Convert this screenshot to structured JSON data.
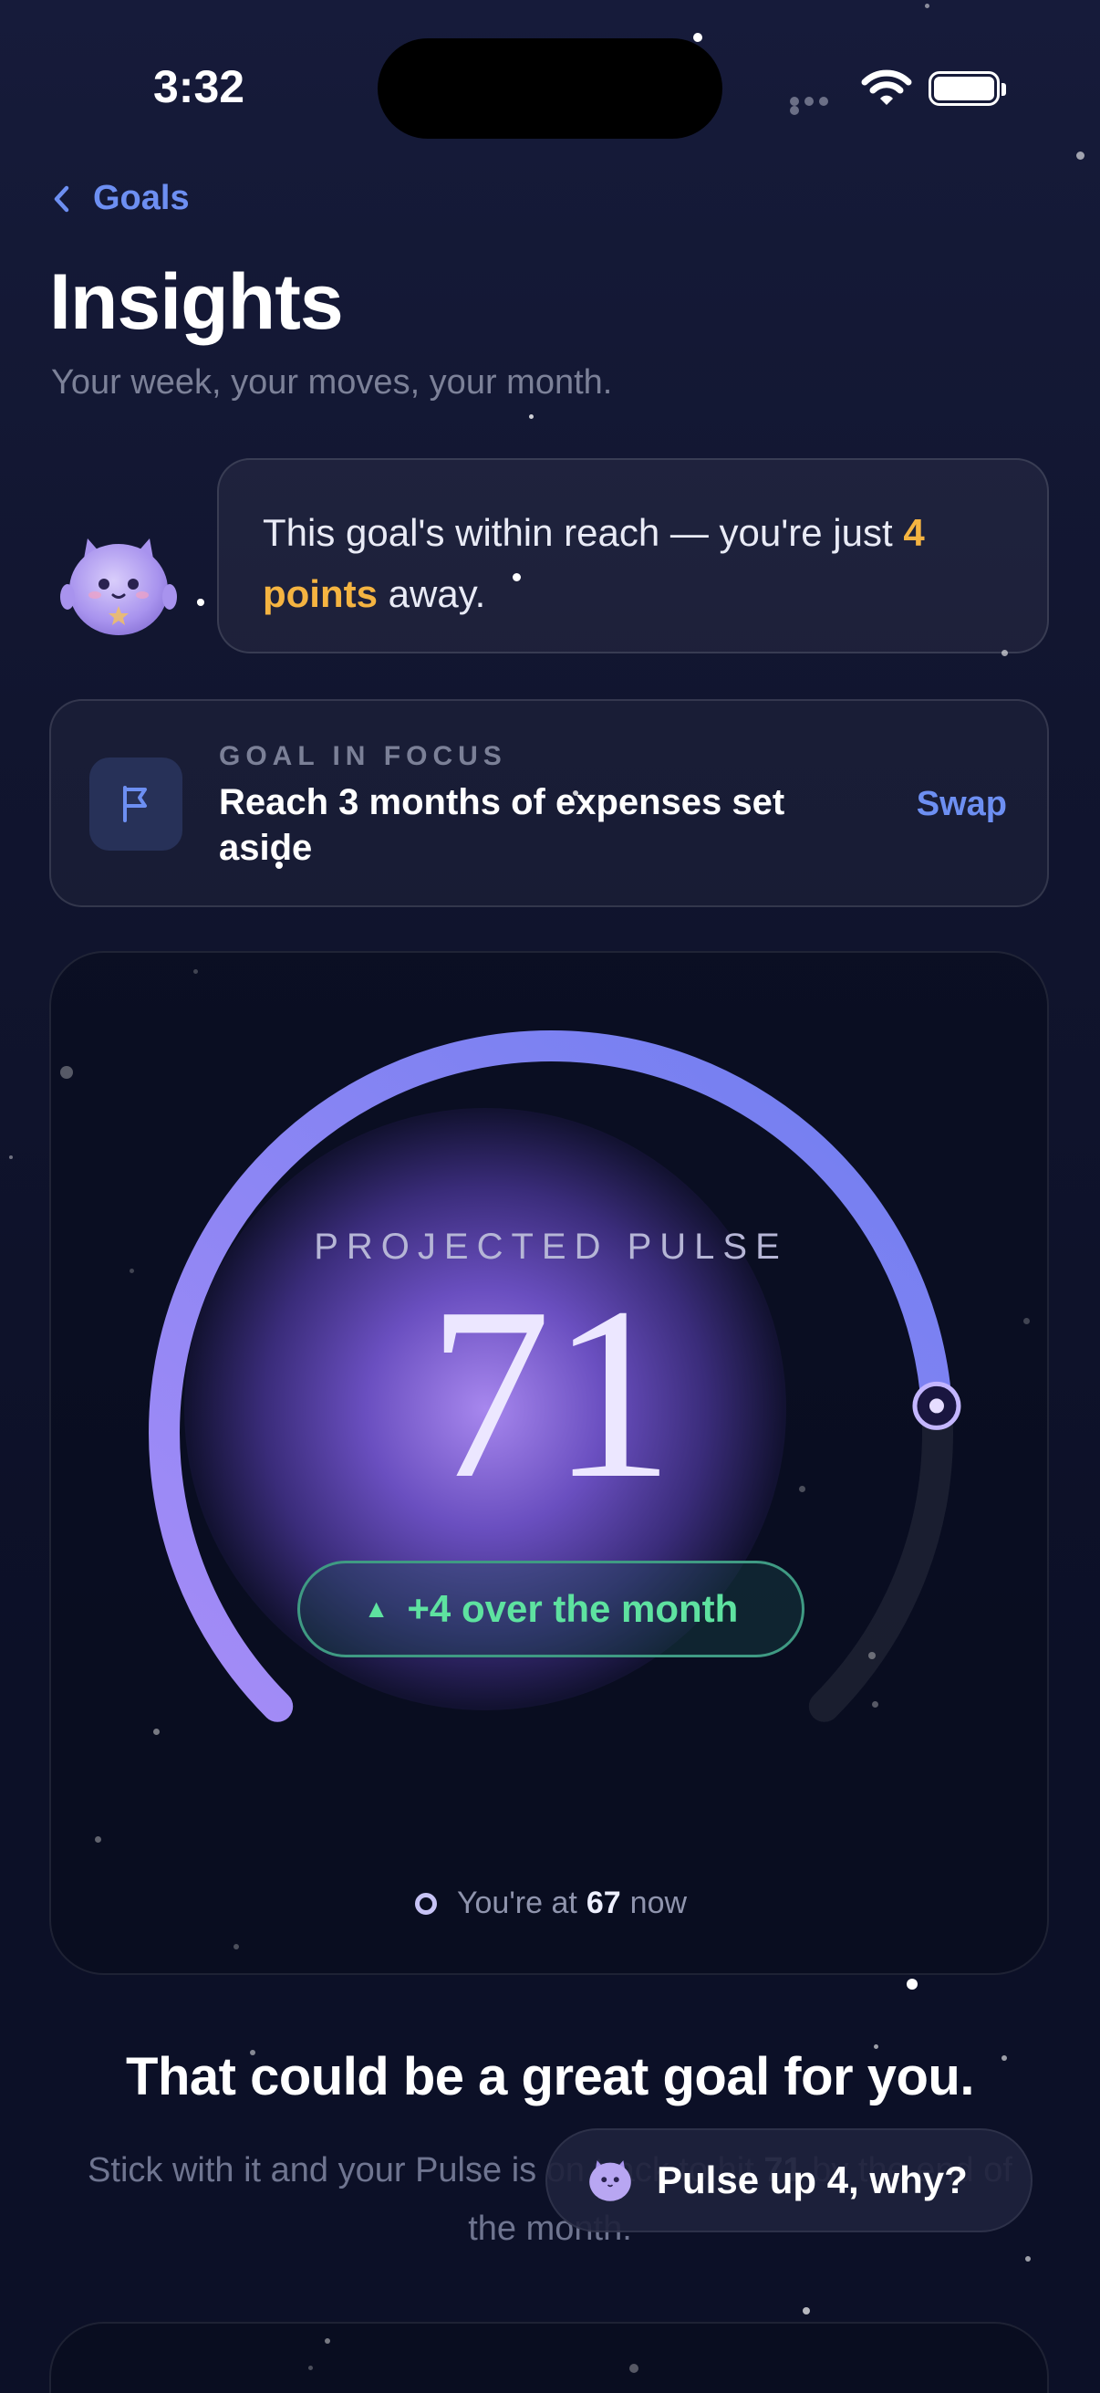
{
  "status_bar": {
    "time": "3:32"
  },
  "nav": {
    "back_label": "Goals"
  },
  "header": {
    "title": "Insights",
    "subtitle": "Your week, your moves, your month."
  },
  "mascot_bubble": {
    "text_before": "This goal's within reach — you're just ",
    "highlight": "4 points",
    "text_after": " away."
  },
  "goal_card": {
    "label": "GOAL IN FOCUS",
    "goal": "Reach 3 months of expenses set aside",
    "action": "Swap"
  },
  "gauge": {
    "label": "PROJECTED PULSE",
    "value": "71",
    "delta": "+4 over the month",
    "now_prefix": "You're at",
    "now_value": "67",
    "now_suffix": "now"
  },
  "summary": {
    "headline": "That could be a great goal for you.",
    "text_before": "Stick with it and your Pulse is on track to hit ",
    "text_value": "71",
    "text_after": " by the end of the month."
  },
  "floating_button": {
    "label": "Pulse up 4, why?"
  },
  "colors": {
    "accent": "#6d8ff2",
    "highlight": "#f5b441",
    "positive": "#5ee2a0",
    "gauge_start": "#a58cf7",
    "gauge_end": "#6f7ef0"
  }
}
